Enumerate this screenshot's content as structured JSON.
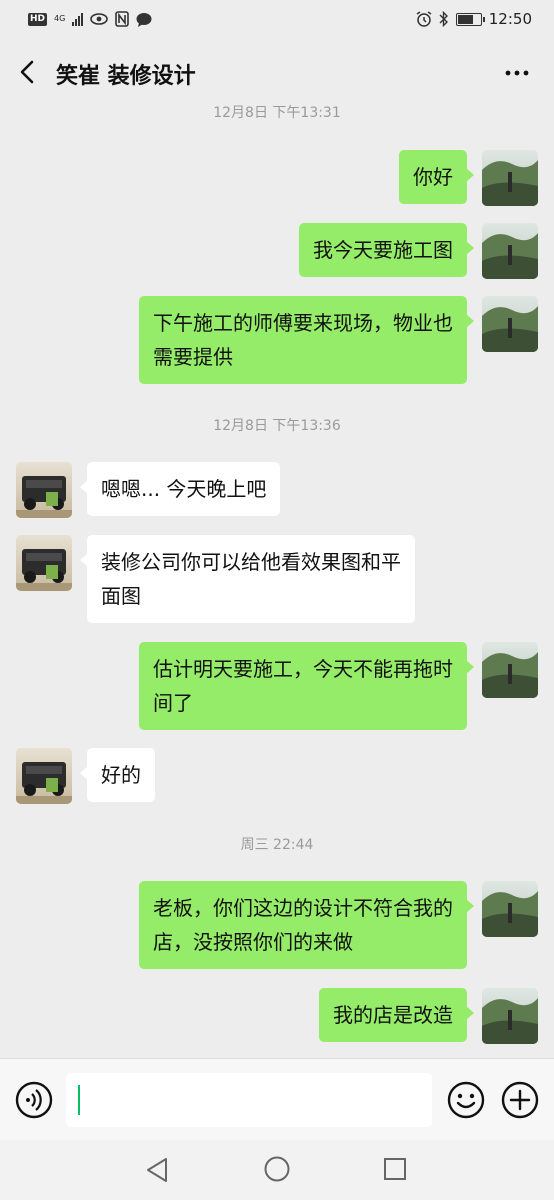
{
  "status_bar": {
    "hd": "HD",
    "network": "4G",
    "time": "12:50",
    "battery_level": 0.7
  },
  "header": {
    "title": "笑崔 装修设计"
  },
  "messages": {
    "t1": "12月8日 下午13:31",
    "m1": "你好",
    "m2": "我今天要施工图",
    "m3_line1": "下午施工的师傅要来现场，物业也",
    "m3_line2": "需要提供",
    "t2": "12月8日 下午13:36",
    "m4": "嗯嗯... 今天晚上吧",
    "m5_line1": "装修公司你可以给他看效果图和平",
    "m5_line2": "面图",
    "m6_line1": "估计明天要施工，今天不能再拖时",
    "m6_line2": "间了",
    "m7": "好的",
    "t3": "周三 22:44",
    "m8_line1": "老板，你们这边的设计不符合我的",
    "m8_line2": "店，没按照你们的来做",
    "m9": "我的店是改造"
  },
  "input": {
    "value": "",
    "placeholder": ""
  },
  "colors": {
    "my_bubble": "#95ec69",
    "other_bubble": "#ffffff",
    "background": "#ededed",
    "accent": "#07c160"
  }
}
